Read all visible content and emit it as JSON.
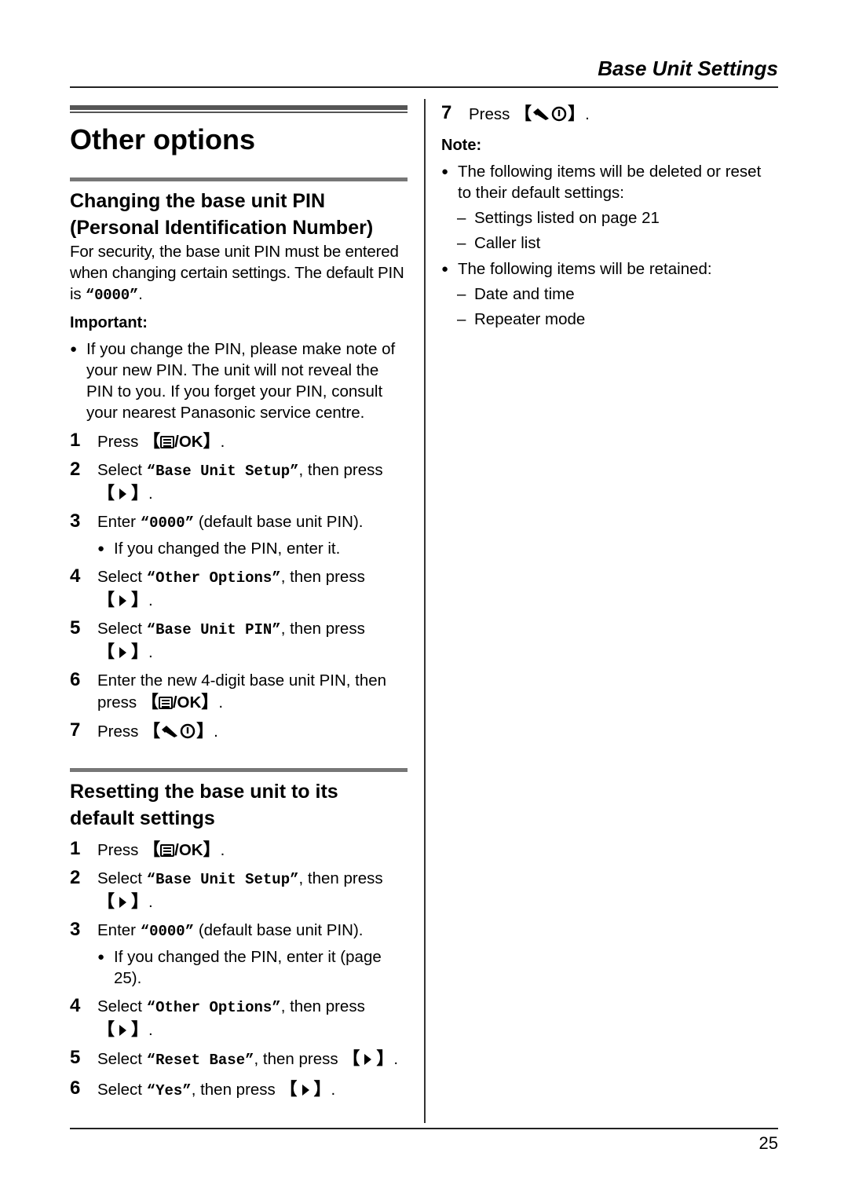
{
  "header": {
    "title": "Base Unit Settings"
  },
  "footer": {
    "page_number": "25"
  },
  "section": {
    "title": "Other options",
    "pin": {
      "title_line1": "Changing the base unit PIN",
      "title_line2": "(Personal Identification Number)",
      "intro_a": "For security, the base unit PIN must be entered when changing certain settings. The default PIN is ",
      "intro_pin": "“0000”",
      "intro_b": ".",
      "important_label": "Important:",
      "important_text": "If you change the PIN, please make note of your new PIN. The unit will not reveal the PIN to you. If you forget your PIN, consult your nearest Panasonic service centre.",
      "steps": [
        {
          "num": "1",
          "pre": "Press ",
          "key": "menu-ok"
        },
        {
          "num": "2",
          "pre": "Select ",
          "code": "“Base Unit Setup”",
          "post": ", then press ",
          "key": "right"
        },
        {
          "num": "3",
          "pre": "Enter ",
          "code": "“0000”",
          "post": " (default base unit PIN).",
          "sub": "If you changed the PIN, enter it."
        },
        {
          "num": "4",
          "pre": "Select ",
          "code": "“Other Options”",
          "post": ", then press ",
          "key": "right"
        },
        {
          "num": "5",
          "pre": "Select ",
          "code": "“Base Unit PIN”",
          "post": ", then press ",
          "key": "right"
        },
        {
          "num": "6",
          "pre": "Enter the new 4-digit base unit PIN, then press ",
          "key": "menu-ok"
        },
        {
          "num": "7",
          "pre": "Press ",
          "key": "off"
        }
      ]
    },
    "reset": {
      "title_line1": "Resetting the base unit to its",
      "title_line2": "default settings",
      "steps": [
        {
          "num": "1",
          "pre": "Press ",
          "key": "menu-ok"
        },
        {
          "num": "2",
          "pre": "Select ",
          "code": "“Base Unit Setup”",
          "post": ", then press ",
          "key": "right"
        },
        {
          "num": "3",
          "pre": "Enter ",
          "code": "“0000”",
          "post": " (default base unit PIN).",
          "sub": "If you changed the PIN, enter it (page 25)."
        },
        {
          "num": "4",
          "pre": "Select ",
          "code": "“Other Options”",
          "post": ", then press ",
          "key": "right"
        },
        {
          "num": "5",
          "pre": "Select ",
          "code": "“Reset Base”",
          "post": ", then press ",
          "key": "right"
        },
        {
          "num": "6",
          "pre": "Select ",
          "code": "“Yes”",
          "post": ", then press ",
          "key": "right"
        },
        {
          "num": "7",
          "pre": "Press ",
          "key": "off"
        }
      ],
      "note_label": "Note:",
      "notes": [
        {
          "text": "The following items will be deleted or reset to their default settings:",
          "items": [
            "Settings listed on page 21",
            "Caller list"
          ]
        },
        {
          "text": "The following items will be retained:",
          "items": [
            "Date and time",
            "Repeater mode"
          ]
        }
      ]
    }
  },
  "keys": {
    "ok_label": "/OK",
    "open_bracket": "【",
    "close_bracket": "】",
    "period": "."
  }
}
